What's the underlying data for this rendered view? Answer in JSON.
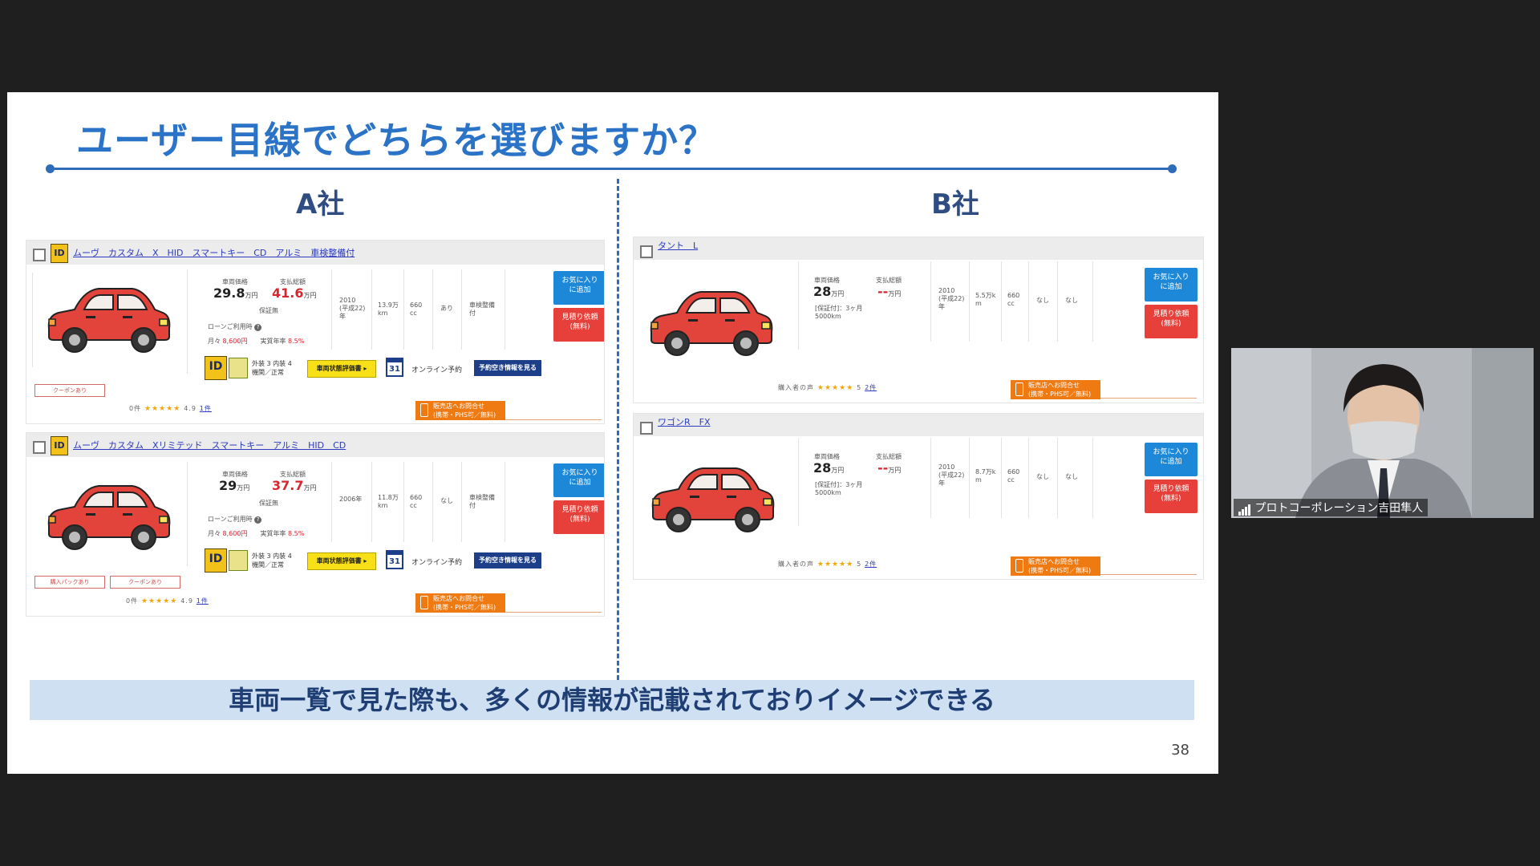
{
  "slide": {
    "title": "ユーザー目線でどちらを選びますか？",
    "company_a": "A社",
    "company_b": "B社",
    "summary": "車両一覧で見た際も、多くの情報が記載されておりイメージできる",
    "page_number": "38"
  },
  "common": {
    "price_label": "車両価格",
    "payment_label": "支払総額",
    "unit_man": "万円",
    "fav_button": "お気に入り\nに追加",
    "quote_button": "見積り依頼\n(無料)",
    "contact_button": "販売店へお問合せ\n(携帯・PHS可／無料)",
    "stars": "★★★★★",
    "eval_button": "車両状態評価書 ▸",
    "online_label": "オンライン予約",
    "reserve_button": "予約空き情報を見る",
    "calendar_day": "31",
    "exterior_text": "外装 3 内装 4\n機関／正常",
    "warranty_label": "保証無",
    "loan_label": "ローンご利用時",
    "monthly_label": "月々",
    "monthly_value": "8,600円",
    "rate_label": "実質年率",
    "rate_value": "8.5%",
    "id_badge": "ID"
  },
  "company_a_cards": [
    {
      "name": "ムーヴ　カスタム　X　HID　スマートキー　CD　アルミ　車検整備付",
      "price": "29.8",
      "payment": "41.6",
      "year": "2010\n(平成22)\n年",
      "mileage": "13.9万\nkm",
      "cc": "660\ncc",
      "inspection": "あり",
      "maintenance": "車検整備\n付",
      "coupons": [
        "クーポンあり"
      ],
      "review_label": "0件",
      "rating": "4.9",
      "review_link": "1件"
    },
    {
      "name": "ムーヴ　カスタム　Xリミテッド　スマートキー　アルミ　HID　CD",
      "price": "29",
      "payment": "37.7",
      "year": "2006年",
      "mileage": "11.8万\nkm",
      "cc": "660\ncc",
      "inspection": "なし",
      "maintenance": "車検整備\n付",
      "coupons": [
        "購入パックあり",
        "クーポンあり"
      ],
      "review_label": "0件",
      "rating": "4.9",
      "review_link": "1件"
    }
  ],
  "company_b_cards": [
    {
      "name": "タント　L",
      "price": "28",
      "payment": "--",
      "warranty": "[保証付]：3ヶ月\n5000km",
      "year": "2010\n(平成22)\n年",
      "mileage": "5.5万k\nm",
      "cc": "660\ncc",
      "inspection": "なし",
      "maintenance": "なし",
      "review_label": "購入者の声",
      "review_link": "2件",
      "rating": "5"
    },
    {
      "name": "ワゴンR　FX",
      "price": "28",
      "payment": "--",
      "warranty": "[保証付]：3ヶ月\n5000km",
      "year": "2010\n(平成22)\n年",
      "mileage": "8.7万k\nm",
      "cc": "660\ncc",
      "inspection": "なし",
      "maintenance": "なし",
      "review_label": "購入者の声",
      "review_link": "2件",
      "rating": "5"
    }
  ],
  "webcam": {
    "participant_name": "プロトコーポレーション吉田隼人"
  },
  "colors": {
    "title_blue": "#2a73c6",
    "rule_blue": "#2e6bb8",
    "summary_bg": "#cfe0f3",
    "car_red": "#e2433b",
    "price_red": "#d9262e"
  }
}
